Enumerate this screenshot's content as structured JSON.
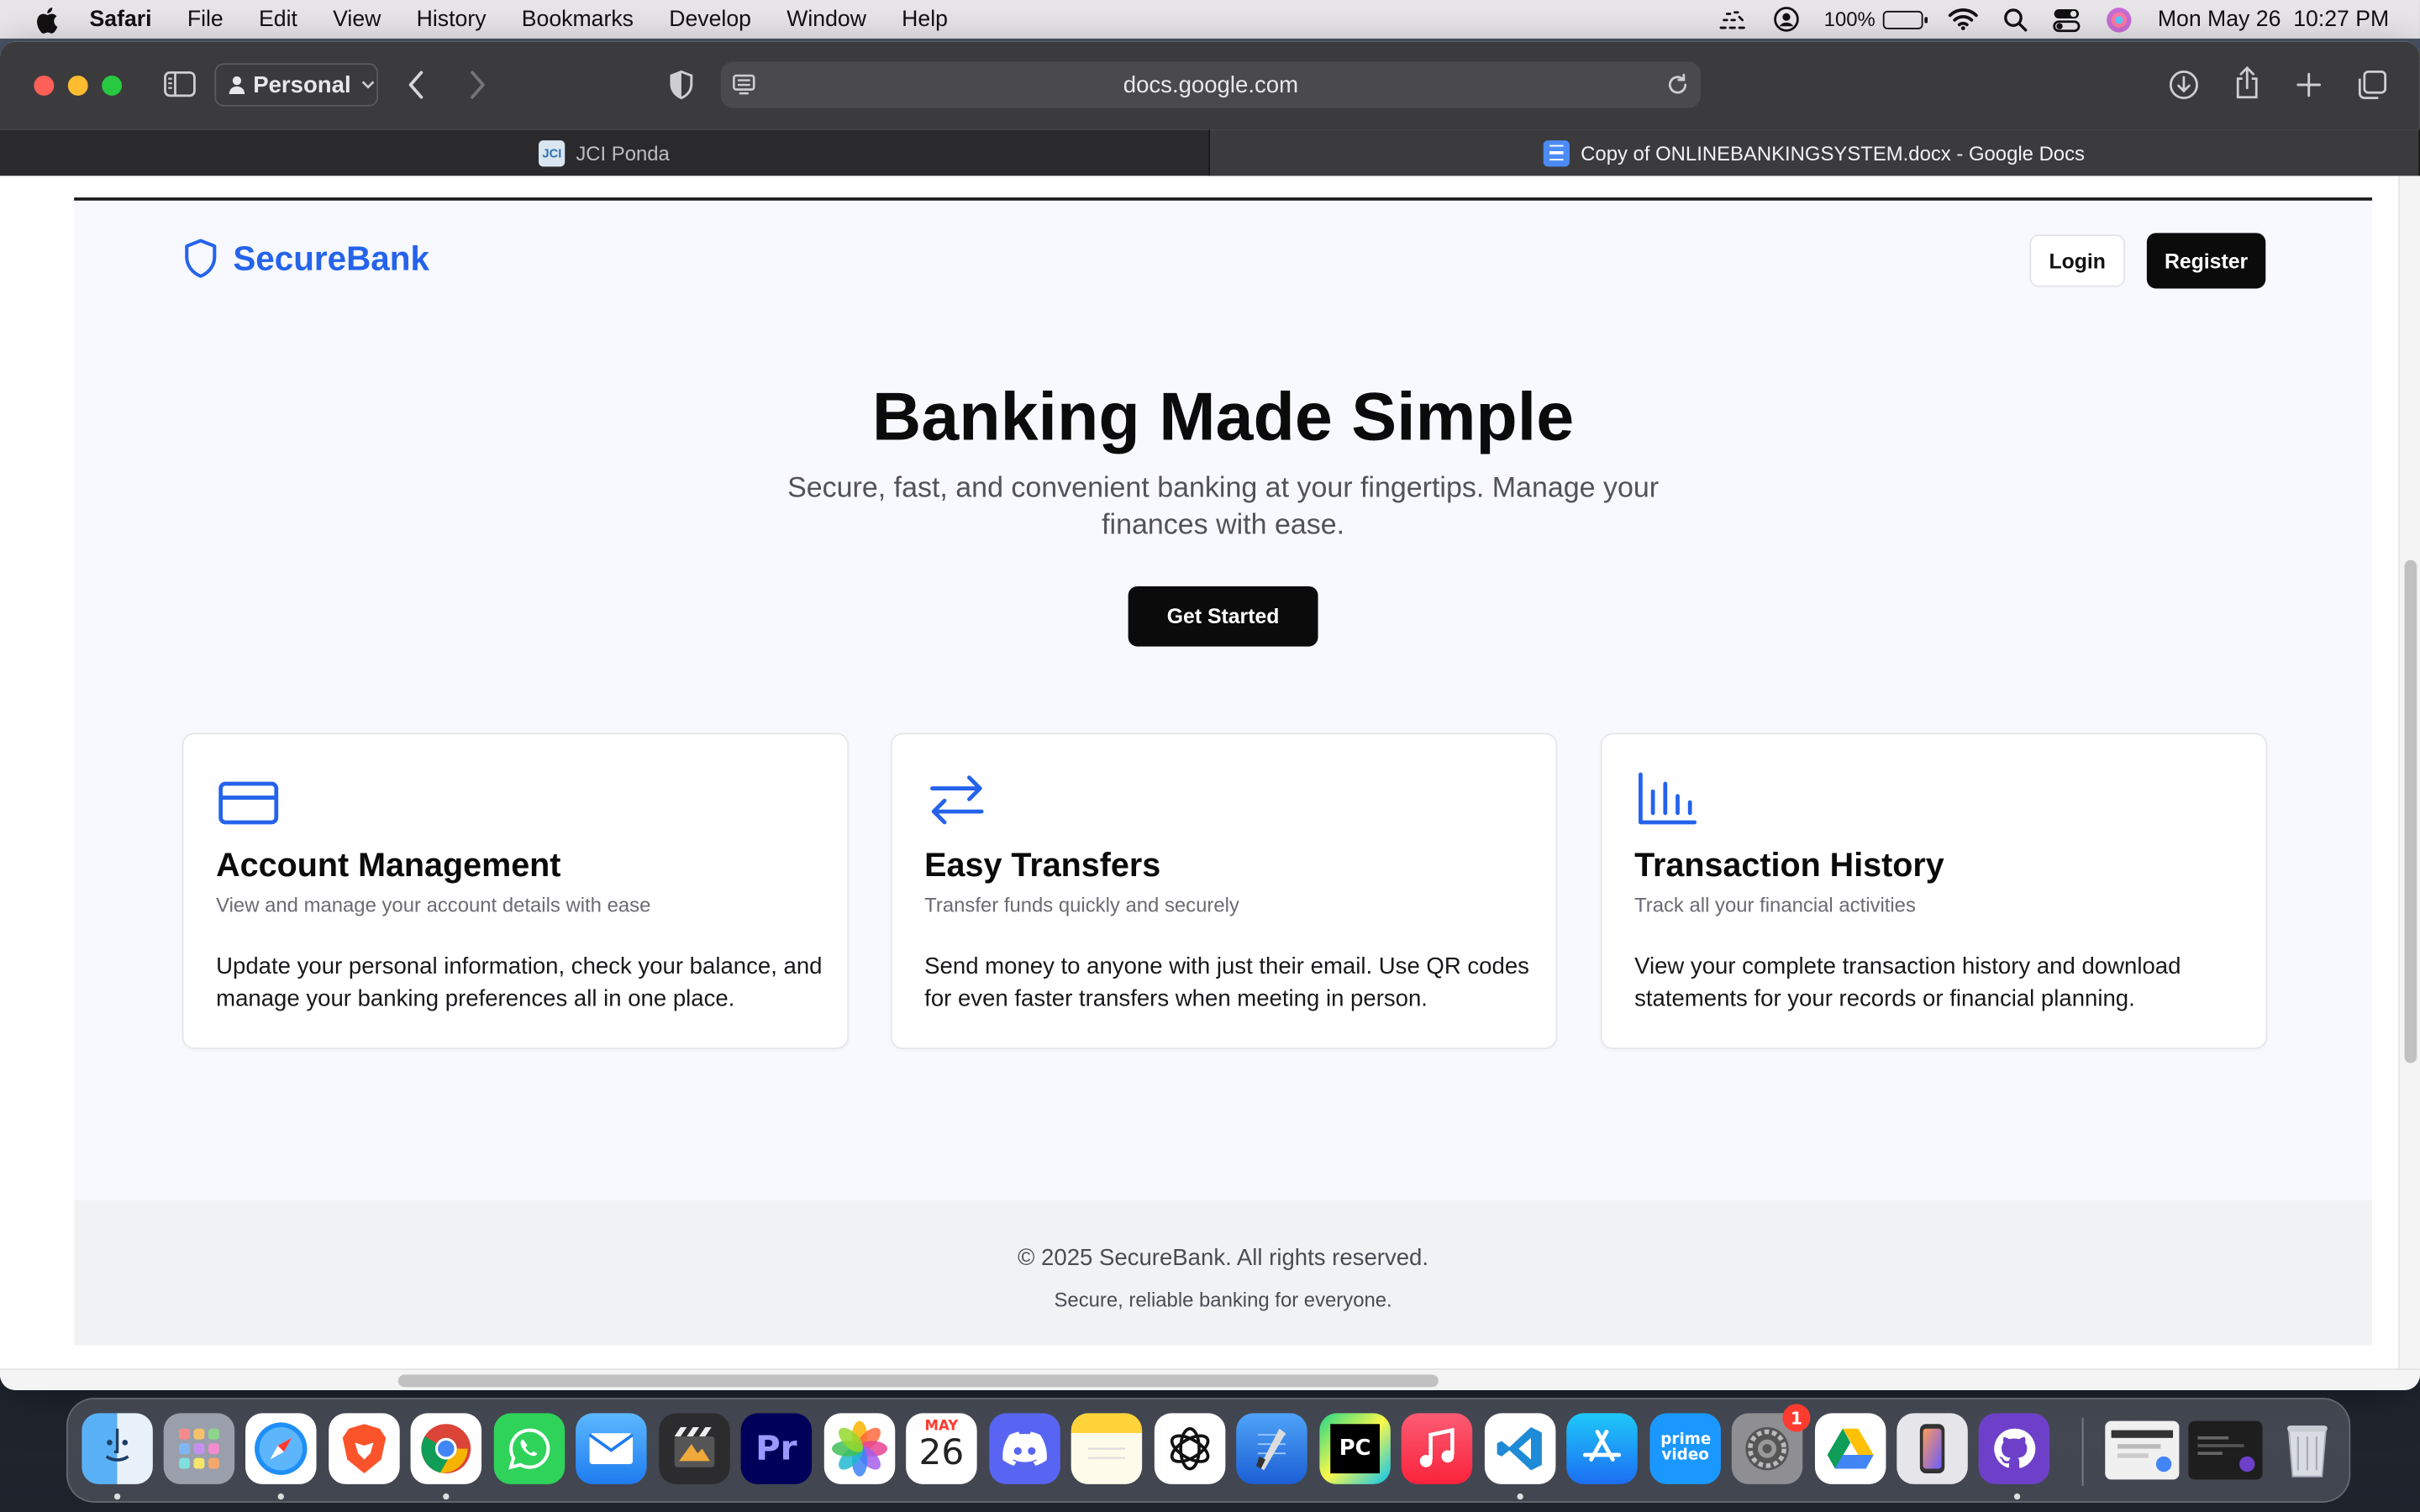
{
  "menubar": {
    "app_name": "Safari",
    "items": [
      "File",
      "Edit",
      "View",
      "History",
      "Bookmarks",
      "Develop",
      "Window",
      "Help"
    ],
    "battery_percent": "100%",
    "datetime": "Mon May 26  10:27 PM"
  },
  "browser": {
    "profile_label": "Personal",
    "url": "docs.google.com",
    "tabs": [
      {
        "title": "JCI Ponda",
        "favicon": "JCI",
        "active": false
      },
      {
        "title": "Copy of ONLINEBANKINGSYSTEM.docx - Google Docs",
        "favicon": "docs-icon",
        "active": true
      }
    ]
  },
  "site": {
    "brand": "SecureBank",
    "brand_color": "#2563eb",
    "nav": {
      "login": "Login",
      "register": "Register"
    },
    "hero": {
      "title": "Banking Made Simple",
      "subtitle": "Secure, fast, and convenient banking at your fingertips. Manage your finances with ease.",
      "cta": "Get Started"
    },
    "features": [
      {
        "icon": "credit-card-icon",
        "title": "Account Management",
        "subtitle": "View and manage your account details with ease",
        "body": "Update your personal information, check your balance, and manage your banking preferences all in one place."
      },
      {
        "icon": "transfer-arrows-icon",
        "title": "Easy Transfers",
        "subtitle": "Transfer funds quickly and securely",
        "body": "Send money to anyone with just their email. Use QR codes for even faster transfers when meeting in person."
      },
      {
        "icon": "bar-chart-icon",
        "title": "Transaction History",
        "subtitle": "Track all your financial activities",
        "body": "View your complete transaction history and download statements for your records or financial planning."
      }
    ],
    "footer": {
      "copyright": "© 2025 SecureBank. All rights reserved.",
      "tagline": "Secure, reliable banking for everyone."
    }
  },
  "dock": {
    "calendar": {
      "month": "MAY",
      "day": "26"
    },
    "premiere_label": "Pr",
    "pycharm_label": "PC",
    "prime_label": "prime video",
    "settings_badge": "1"
  }
}
